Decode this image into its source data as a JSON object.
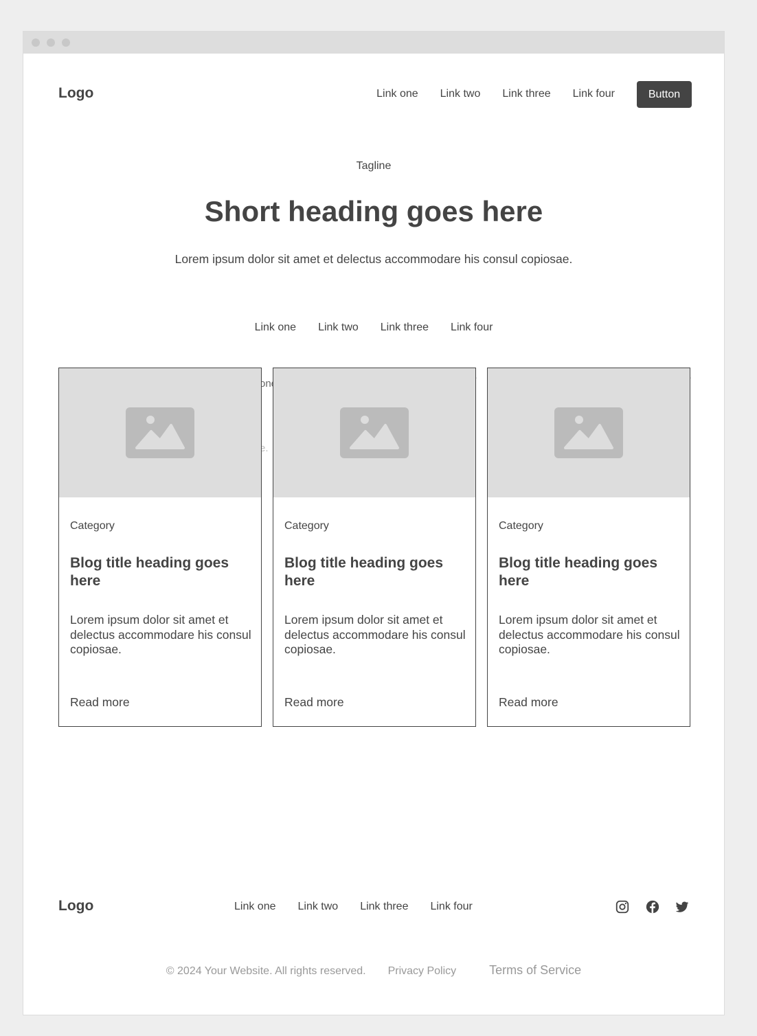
{
  "nav": {
    "logo": "Logo",
    "links": [
      "Link one",
      "Link two",
      "Link three",
      "Link four"
    ],
    "button": "Button"
  },
  "hero": {
    "tagline": "Tagline",
    "heading": "Short heading goes here",
    "description": "Lorem ipsum dolor sit amet et delectus accommodare his consul copiosae."
  },
  "filters": [
    "Link one",
    "Link two",
    "Link three",
    "Link four"
  ],
  "ghost": {
    "a": "one",
    "b": "e.",
    "c": "·",
    "d": "·"
  },
  "cards": [
    {
      "category": "Category",
      "title": "Blog title heading goes here",
      "description": "Lorem ipsum dolor sit amet et delectus accommodare his consul copiosae.",
      "cta": "Read more",
      "image_icon": "image-placeholder-icon"
    },
    {
      "category": "Category",
      "title": "Blog title heading goes here",
      "description": "Lorem ipsum dolor sit amet et delectus accommodare his consul copiosae.",
      "cta": "Read more",
      "image_icon": "image-placeholder-icon"
    },
    {
      "category": "Category",
      "title": "Blog title heading goes here",
      "description": "Lorem ipsum dolor sit amet et delectus accommodare his consul copiosae.",
      "cta": "Read more",
      "image_icon": "image-placeholder-icon"
    }
  ],
  "footer": {
    "logo": "Logo",
    "links": [
      "Link one",
      "Link two",
      "Link three",
      "Link four"
    ],
    "social": [
      "instagram-icon",
      "facebook-icon",
      "twitter-icon"
    ],
    "copyright": "© 2024 Your Website. All rights reserved.",
    "privacy": "Privacy Policy",
    "terms": "Terms of Service"
  },
  "colors": {
    "text": "#444444",
    "muted": "#999999",
    "placeholder": "#dddddd",
    "button": "#444444"
  }
}
